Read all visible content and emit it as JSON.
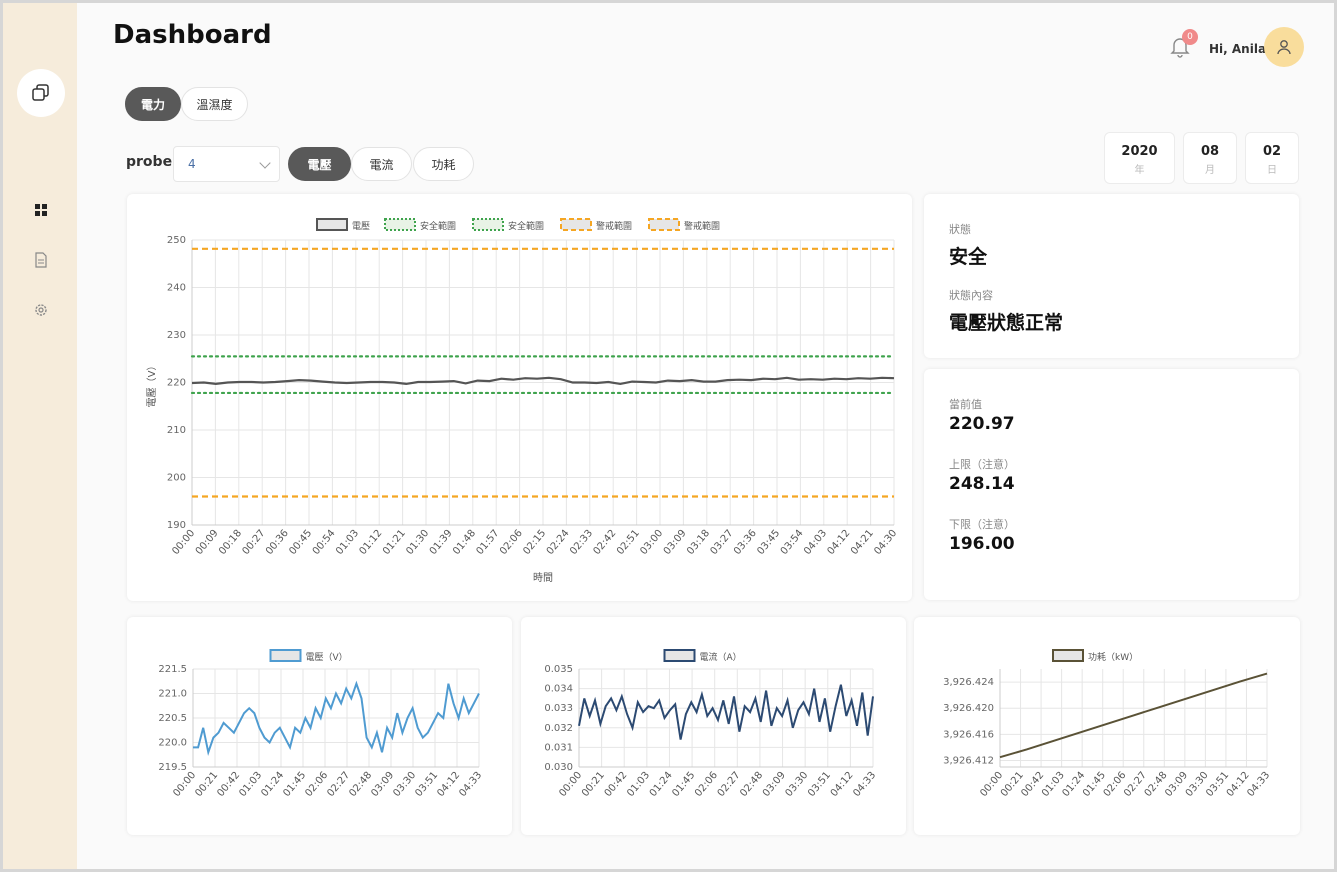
{
  "page": {
    "title": "Dashboard"
  },
  "header": {
    "notifications": "0",
    "greeting": "Hi, Anila"
  },
  "sidebar": {
    "items": [
      {
        "icon": "dashboard-grid-icon",
        "label": "dashboard"
      },
      {
        "icon": "document-icon",
        "label": "reports"
      },
      {
        "icon": "gear-icon",
        "label": "settings"
      }
    ]
  },
  "tabs": [
    {
      "label": "電力",
      "active": true
    },
    {
      "label": "溫濕度",
      "active": false
    }
  ],
  "probe": {
    "label": "probe",
    "value": "4"
  },
  "metric_tabs": [
    {
      "label": "電壓",
      "active": true
    },
    {
      "label": "電流",
      "active": false
    },
    {
      "label": "功耗",
      "active": false
    }
  ],
  "date": {
    "year": "2020",
    "year_unit": "年",
    "month": "08",
    "month_unit": "月",
    "day": "02",
    "day_unit": "日"
  },
  "status": {
    "label": "狀態",
    "value": "安全",
    "content_label": "狀態內容",
    "content_value": "電壓狀態正常"
  },
  "readings": {
    "current_label": "當前值",
    "current_value": "220.97",
    "upper_label": "上限（注意）",
    "upper_value": "248.14",
    "lower_label": "下限（注意）",
    "lower_value": "196.00"
  },
  "colors": {
    "sidebar": "#f6ecdb",
    "active_pill": "#595959",
    "warning": "#f5a623",
    "safe": "#3fa34d",
    "voltage_main": "#555555",
    "voltage_small": "#4f9bd1",
    "current_small": "#2c4a72",
    "power_small": "#5a5236"
  },
  "chart_data": [
    {
      "type": "line",
      "title": "",
      "xlabel": "時間",
      "ylabel": "電壓（V）",
      "ylim": [
        190,
        250
      ],
      "yticks": [
        "190",
        "200",
        "210",
        "220",
        "230",
        "240",
        "250"
      ],
      "categories": [
        "00:00",
        "00:09",
        "00:18",
        "00:27",
        "00:36",
        "00:45",
        "00:54",
        "01:03",
        "01:12",
        "01:21",
        "01:30",
        "01:39",
        "01:48",
        "01:57",
        "02:06",
        "02:15",
        "02:24",
        "02:33",
        "02:42",
        "02:51",
        "03:00",
        "03:09",
        "03:18",
        "03:27",
        "03:36",
        "03:45",
        "03:54",
        "04:03",
        "04:12",
        "04:21",
        "04:30"
      ],
      "legend": [
        "電壓",
        "安全範圍",
        "安全範圍",
        "警戒範圍",
        "警戒範圍"
      ],
      "legend_position": "top",
      "grid": true,
      "series": [
        {
          "name": "電壓",
          "color": "#555555",
          "style": "solid",
          "values": [
            219.9,
            220.0,
            219.7,
            220.0,
            220.1,
            220.1,
            220.0,
            220.1,
            220.3,
            220.5,
            220.4,
            220.2,
            220.0,
            219.9,
            220.0,
            220.1,
            220.1,
            220.0,
            219.7,
            220.1,
            220.1,
            220.2,
            220.3,
            219.8,
            220.4,
            220.3,
            220.8,
            220.6,
            220.9,
            220.8,
            221.0,
            220.7,
            220.0,
            220.0,
            219.9,
            220.1,
            219.7,
            220.2,
            220.1,
            220.0,
            220.4,
            220.3,
            220.5,
            220.2,
            220.2,
            220.5,
            220.6,
            220.5,
            220.8,
            220.7,
            221.0,
            220.6,
            220.7,
            220.6,
            220.8,
            220.7,
            220.9,
            220.8,
            221.0,
            220.9
          ]
        },
        {
          "name": "安全範圍",
          "color": "#3fa34d",
          "style": "dotted",
          "values": [
            225.5
          ]
        },
        {
          "name": "安全範圍",
          "color": "#3fa34d",
          "style": "dotted",
          "values": [
            217.8
          ]
        },
        {
          "name": "警戒範圍",
          "color": "#f5a623",
          "style": "dashed",
          "values": [
            248.14
          ]
        },
        {
          "name": "警戒範圍",
          "color": "#f5a623",
          "style": "dashed",
          "values": [
            196.0
          ]
        }
      ]
    },
    {
      "type": "line",
      "legend": [
        "電壓（V）"
      ],
      "ylim": [
        219.5,
        221.5
      ],
      "yticks": [
        "219.5",
        "220.0",
        "220.5",
        "221.0",
        "221.5"
      ],
      "categories": [
        "00:00",
        "00:21",
        "00:42",
        "01:03",
        "01:24",
        "01:45",
        "02:06",
        "02:27",
        "02:48",
        "03:09",
        "03:30",
        "03:51",
        "04:12",
        "04:33"
      ],
      "series": [
        {
          "name": "電壓（V）",
          "color": "#4f9bd1",
          "values": [
            219.9,
            219.9,
            220.3,
            219.8,
            220.1,
            220.2,
            220.4,
            220.3,
            220.2,
            220.4,
            220.6,
            220.7,
            220.6,
            220.3,
            220.1,
            220.0,
            220.2,
            220.3,
            220.1,
            219.9,
            220.3,
            220.2,
            220.5,
            220.3,
            220.7,
            220.5,
            220.9,
            220.7,
            221.0,
            220.8,
            221.1,
            220.9,
            221.2,
            220.9,
            220.1,
            219.9,
            220.2,
            219.8,
            220.3,
            220.1,
            220.6,
            220.2,
            220.5,
            220.7,
            220.3,
            220.1,
            220.2,
            220.4,
            220.6,
            220.5,
            221.2,
            220.8,
            220.5,
            220.9,
            220.6,
            220.8,
            221.0
          ]
        }
      ]
    },
    {
      "type": "line",
      "legend": [
        "電流（A）"
      ],
      "ylim": [
        0.03,
        0.035
      ],
      "yticks": [
        "0.030",
        "0.031",
        "0.032",
        "0.033",
        "0.034",
        "0.035"
      ],
      "categories": [
        "00:00",
        "00:21",
        "00:42",
        "01:03",
        "01:24",
        "01:45",
        "02:06",
        "02:27",
        "02:48",
        "03:09",
        "03:30",
        "03:51",
        "04:12",
        "04:33"
      ],
      "series": [
        {
          "name": "電流（A）",
          "color": "#2c4a72",
          "values": [
            0.0321,
            0.0335,
            0.0326,
            0.0334,
            0.0322,
            0.0331,
            0.0335,
            0.0329,
            0.0336,
            0.0327,
            0.032,
            0.0333,
            0.0328,
            0.0331,
            0.033,
            0.0334,
            0.0325,
            0.0329,
            0.0332,
            0.0314,
            0.0327,
            0.0333,
            0.0328,
            0.0337,
            0.0326,
            0.033,
            0.0324,
            0.0334,
            0.0322,
            0.0336,
            0.0318,
            0.0331,
            0.0328,
            0.0335,
            0.0323,
            0.0339,
            0.0321,
            0.033,
            0.0326,
            0.0334,
            0.032,
            0.0329,
            0.0333,
            0.0327,
            0.034,
            0.0323,
            0.0335,
            0.0318,
            0.0331,
            0.0342,
            0.0326,
            0.0334,
            0.0321,
            0.0338,
            0.0316,
            0.0336
          ]
        }
      ]
    },
    {
      "type": "line",
      "legend": [
        "功耗（kW）"
      ],
      "ylim": [
        3926.411,
        3926.426
      ],
      "yticks": [
        "3,926.412",
        "3,926.416",
        "3,926.420",
        "3,926.424"
      ],
      "categories": [
        "00:00",
        "00:21",
        "00:42",
        "01:03",
        "01:24",
        "01:45",
        "02:06",
        "02:27",
        "02:48",
        "03:09",
        "03:30",
        "03:51",
        "04:12",
        "04:33"
      ],
      "series": [
        {
          "name": "功耗（kW）",
          "color": "#5a5236",
          "values": [
            3926.4125,
            3926.4137,
            3926.415,
            3926.4163,
            3926.4176,
            3926.4189,
            3926.4202,
            3926.4215,
            3926.4228,
            3926.4241,
            3926.4253
          ]
        }
      ]
    }
  ]
}
